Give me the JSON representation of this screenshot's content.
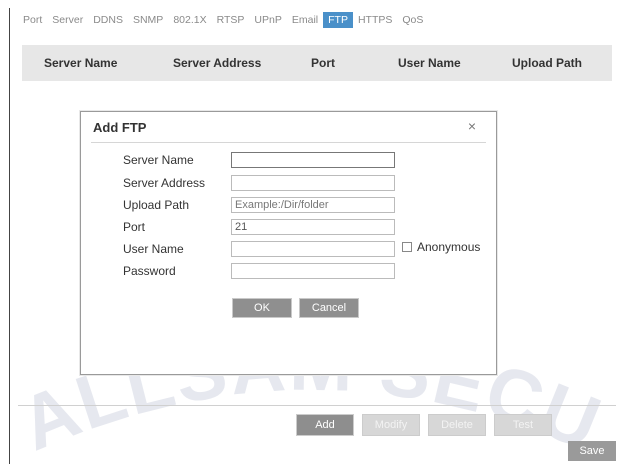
{
  "tabs": [
    {
      "label": "Port",
      "active": false
    },
    {
      "label": "Server",
      "active": false
    },
    {
      "label": "DDNS",
      "active": false
    },
    {
      "label": "SNMP",
      "active": false
    },
    {
      "label": "802.1X",
      "active": false
    },
    {
      "label": "RTSP",
      "active": false
    },
    {
      "label": "UPnP",
      "active": false
    },
    {
      "label": "Email",
      "active": false
    },
    {
      "label": "FTP",
      "active": true
    },
    {
      "label": "HTTPS",
      "active": false
    },
    {
      "label": "QoS",
      "active": false
    }
  ],
  "table": {
    "columns": [
      "Server Name",
      "Server Address",
      "Port",
      "User Name",
      "Upload Path"
    ]
  },
  "actions": {
    "add": "Add",
    "modify": "Modify",
    "delete": "Delete",
    "test": "Test",
    "save": "Save"
  },
  "dialog": {
    "title": "Add FTP",
    "close": "×",
    "fields": {
      "server_name": {
        "label": "Server Name",
        "value": ""
      },
      "server_address": {
        "label": "Server Address",
        "value": ""
      },
      "upload_path": {
        "label": "Upload Path",
        "placeholder": "Example:/Dir/folder"
      },
      "port": {
        "label": "Port",
        "value": "21"
      },
      "user_name": {
        "label": "User Name",
        "value": ""
      },
      "password": {
        "label": "Password",
        "value": ""
      }
    },
    "anonymous_label": "Anonymous",
    "anonymous_checked": false,
    "ok": "OK",
    "cancel": "Cancel"
  },
  "watermark": {
    "text": "ALLSAM SECU"
  },
  "colors": {
    "active_tab": "#4a90c9",
    "button": "#8f8f8f",
    "header_bg": "#e7e7e7"
  }
}
